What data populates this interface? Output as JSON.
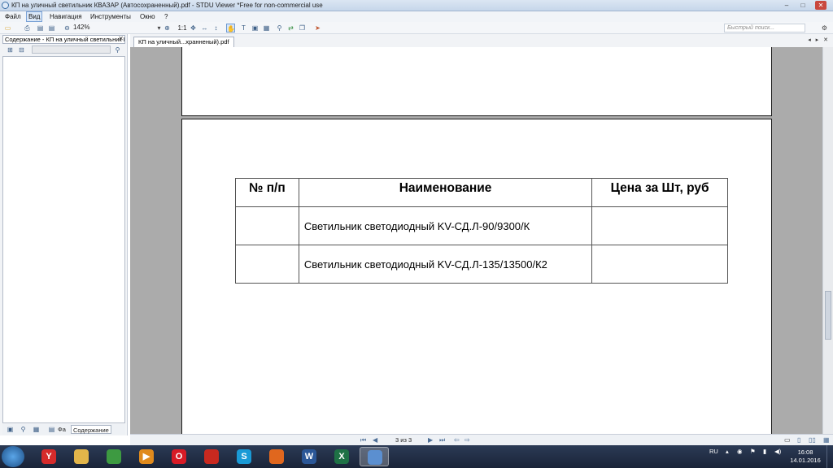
{
  "window": {
    "title": "КП на уличный светильник КВАЗАР (Автосохраненный).pdf - STDU Viewer *Free for non-commercial use",
    "controls": {
      "minimize": "–",
      "maximize": "□",
      "close": "✕"
    }
  },
  "menu": {
    "items": [
      {
        "label": "Файл"
      },
      {
        "label": "Вид",
        "active": true
      },
      {
        "label": "Навигация"
      },
      {
        "label": "Инструменты"
      },
      {
        "label": "Окно"
      },
      {
        "label": "?"
      }
    ]
  },
  "toolbar": {
    "zoom": "142%",
    "actual_size_label": "1:1",
    "search_placeholder": "Быстрый поиск..."
  },
  "sidebar": {
    "header": "Содержание - КП на уличный светильник КВАЗАР",
    "close": "✕",
    "tabs": [
      {
        "label": "Фа"
      },
      {
        "label": "Содержание",
        "active": true
      }
    ]
  },
  "doc_tab": {
    "label": "КП на уличный...хранненый).pdf"
  },
  "document": {
    "table": {
      "headers": [
        "№ п/п",
        "Наименование",
        "Цена за Шт, руб"
      ],
      "rows": [
        [
          "",
          "Светильник светодиодный KV-СД.Л-90/9300/К",
          ""
        ],
        [
          "",
          "Светильник светодиодный KV-СД.Л-135/13500/К2",
          ""
        ]
      ]
    }
  },
  "statusbar": {
    "page_info": "3 из 3"
  },
  "taskbar": {
    "apps": [
      {
        "icon": "yandex-browser-icon",
        "glyph": "Y",
        "color": "#d62b2b"
      },
      {
        "icon": "file-explorer-icon",
        "glyph": "",
        "color": "#e2b54a"
      },
      {
        "icon": "chrome-icon",
        "glyph": "",
        "color": "#3d9a41"
      },
      {
        "icon": "media-player-icon",
        "glyph": "▶",
        "color": "#e08a1c"
      },
      {
        "icon": "opera-icon",
        "glyph": "O",
        "color": "#d81b26"
      },
      {
        "icon": "pdf-reader-icon",
        "glyph": "",
        "color": "#c9291f"
      },
      {
        "icon": "skype-icon",
        "glyph": "S",
        "color": "#1a9ad6"
      },
      {
        "icon": "firefox-icon",
        "glyph": "",
        "color": "#e0671e"
      },
      {
        "icon": "word-icon",
        "glyph": "W",
        "color": "#2b5797"
      },
      {
        "icon": "excel-icon",
        "glyph": "X",
        "color": "#1e7145"
      },
      {
        "icon": "stdu-viewer-icon",
        "glyph": "",
        "color": "#5b8fd0",
        "active": true
      }
    ],
    "language": "RU",
    "time": "16:08",
    "date": "14.01.2016"
  }
}
